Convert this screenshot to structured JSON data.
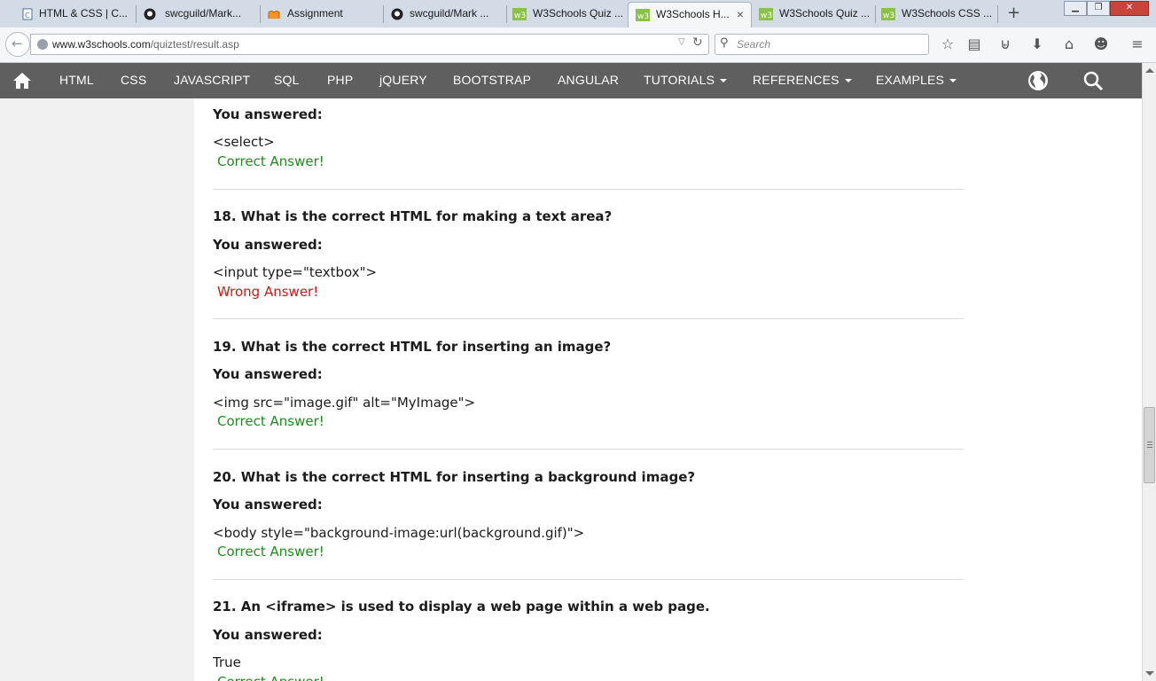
{
  "browser": {
    "tabs": [
      {
        "label": "HTML & CSS | C...",
        "icon": "doc-icon"
      },
      {
        "label": "swcguild/Mark...",
        "icon": "github-icon"
      },
      {
        "label": "Assignment",
        "icon": "moodle-icon"
      },
      {
        "label": "swcguild/Mark ...",
        "icon": "github-icon"
      },
      {
        "label": "W3Schools Quiz ...",
        "icon": "w3-icon"
      },
      {
        "label": "W3Schools H...",
        "icon": "w3-icon",
        "active": true,
        "close": "×"
      },
      {
        "label": "W3Schools Quiz ...",
        "icon": "w3-icon"
      },
      {
        "label": "W3Schools CSS ...",
        "icon": "w3-icon"
      }
    ],
    "new_tab": "+",
    "url_domain": "www.w3schools.com",
    "url_path": "/quiztest/result.asp",
    "search_placeholder": "Search"
  },
  "w3nav": {
    "items": [
      {
        "label": "HTML",
        "dropdown": false
      },
      {
        "label": "CSS",
        "dropdown": false
      },
      {
        "label": "JAVASCRIPT",
        "dropdown": false
      },
      {
        "label": "SQL",
        "dropdown": false
      },
      {
        "label": "PHP",
        "dropdown": false
      },
      {
        "label": "jQUERY",
        "dropdown": false
      },
      {
        "label": "BOOTSTRAP",
        "dropdown": false
      },
      {
        "label": "ANGULAR",
        "dropdown": false
      },
      {
        "label": "TUTORIALS",
        "dropdown": true
      },
      {
        "label": "REFERENCES",
        "dropdown": true
      },
      {
        "label": "EXAMPLES",
        "dropdown": true
      }
    ]
  },
  "quiz": {
    "you_answered_label": "You answered:",
    "top_partial": {
      "answer": "<select>",
      "result": "Correct Answer!",
      "correct": true
    },
    "questions": [
      {
        "title": "18. What is the correct HTML for making a text area?",
        "answer": "<input type=\"textbox\">",
        "result": "Wrong Answer!",
        "correct": false
      },
      {
        "title": "19. What is the correct HTML for inserting an image?",
        "answer": "<img src=\"image.gif\" alt=\"MyImage\">",
        "result": "Correct Answer!",
        "correct": true
      },
      {
        "title": "20. What is the correct HTML for inserting a background image?",
        "answer": "<body style=\"background-image:url(background.gif)\">",
        "result": "Correct Answer!",
        "correct": true
      },
      {
        "title": "21. An <iframe> is used to display a web page within a web page.",
        "answer": "True",
        "result": "Correct Answer!",
        "correct": true
      }
    ]
  },
  "colors": {
    "correct": "#1e8c1e",
    "wrong": "#d41414",
    "nav_bg": "#5f5f5f"
  }
}
